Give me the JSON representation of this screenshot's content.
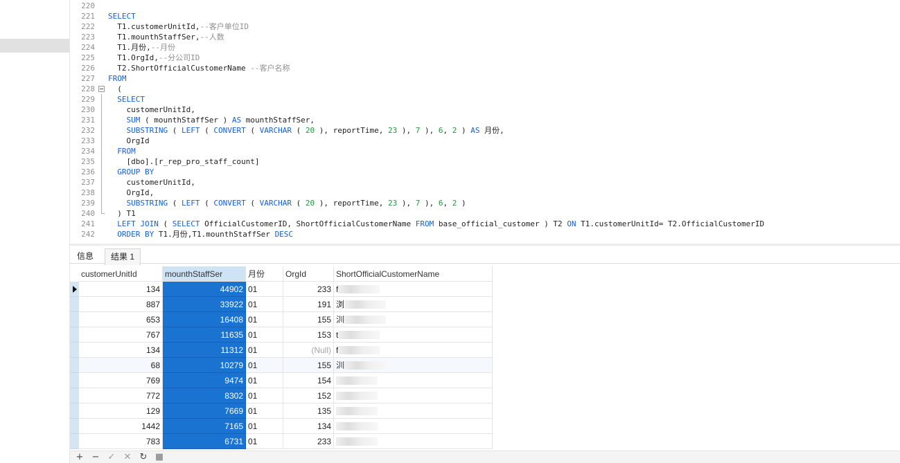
{
  "editor": {
    "lines": [
      {
        "n": "220",
        "segs": []
      },
      {
        "n": "221",
        "segs": [
          {
            "t": "SELECT",
            "c": "kw"
          }
        ]
      },
      {
        "n": "222",
        "segs": [
          {
            "t": "  T1.customerUnitId,",
            "c": ""
          },
          {
            "t": "--客户单位ID",
            "c": "cmt"
          }
        ]
      },
      {
        "n": "223",
        "segs": [
          {
            "t": "  T1.mounthStaffSer,",
            "c": ""
          },
          {
            "t": "--人数",
            "c": "cmt"
          }
        ]
      },
      {
        "n": "224",
        "segs": [
          {
            "t": "  T1.月份,",
            "c": ""
          },
          {
            "t": "--月份",
            "c": "cmt"
          }
        ]
      },
      {
        "n": "225",
        "segs": [
          {
            "t": "  T1.OrgId,",
            "c": ""
          },
          {
            "t": "--分公司ID",
            "c": "cmt"
          }
        ]
      },
      {
        "n": "226",
        "segs": [
          {
            "t": "  T2.ShortOfficialCustomerName ",
            "c": ""
          },
          {
            "t": "--客户名称",
            "c": "cmt"
          }
        ]
      },
      {
        "n": "227",
        "segs": [
          {
            "t": "FROM",
            "c": "kw"
          }
        ]
      },
      {
        "n": "228",
        "fold": "box",
        "segs": [
          {
            "t": "  (",
            "c": ""
          }
        ]
      },
      {
        "n": "229",
        "fold": "line",
        "segs": [
          {
            "t": "  SELECT",
            "c": "kw"
          }
        ]
      },
      {
        "n": "230",
        "fold": "line",
        "segs": [
          {
            "t": "    customerUnitId,",
            "c": ""
          }
        ]
      },
      {
        "n": "231",
        "fold": "line",
        "segs": [
          {
            "t": "    ",
            "c": ""
          },
          {
            "t": "SUM",
            "c": "kw"
          },
          {
            "t": " ( mounthStaffSer ) ",
            "c": ""
          },
          {
            "t": "AS",
            "c": "kw"
          },
          {
            "t": " mounthStaffSer,",
            "c": ""
          }
        ]
      },
      {
        "n": "232",
        "fold": "line",
        "segs": [
          {
            "t": "    ",
            "c": ""
          },
          {
            "t": "SUBSTRING",
            "c": "kw"
          },
          {
            "t": " ( ",
            "c": ""
          },
          {
            "t": "LEFT",
            "c": "kw"
          },
          {
            "t": " ( ",
            "c": ""
          },
          {
            "t": "CONVERT",
            "c": "kw"
          },
          {
            "t": " ( ",
            "c": ""
          },
          {
            "t": "VARCHAR",
            "c": "kw"
          },
          {
            "t": " ( ",
            "c": ""
          },
          {
            "t": "20",
            "c": "num"
          },
          {
            "t": " ), reportTime, ",
            "c": ""
          },
          {
            "t": "23",
            "c": "num"
          },
          {
            "t": " ), ",
            "c": ""
          },
          {
            "t": "7",
            "c": "num"
          },
          {
            "t": " ), ",
            "c": ""
          },
          {
            "t": "6",
            "c": "num"
          },
          {
            "t": ", ",
            "c": ""
          },
          {
            "t": "2",
            "c": "num"
          },
          {
            "t": " ) ",
            "c": ""
          },
          {
            "t": "AS",
            "c": "kw"
          },
          {
            "t": " 月份,",
            "c": ""
          }
        ]
      },
      {
        "n": "233",
        "fold": "line",
        "segs": [
          {
            "t": "    OrgId",
            "c": ""
          }
        ]
      },
      {
        "n": "234",
        "fold": "line",
        "segs": [
          {
            "t": "  FROM",
            "c": "kw"
          }
        ]
      },
      {
        "n": "235",
        "fold": "line",
        "segs": [
          {
            "t": "    [dbo].[r_rep_pro_staff_count]",
            "c": ""
          }
        ]
      },
      {
        "n": "236",
        "fold": "line",
        "segs": [
          {
            "t": "  GROUP BY",
            "c": "kw"
          }
        ]
      },
      {
        "n": "237",
        "fold": "line",
        "segs": [
          {
            "t": "    customerUnitId,",
            "c": ""
          }
        ]
      },
      {
        "n": "238",
        "fold": "line",
        "segs": [
          {
            "t": "    OrgId,",
            "c": ""
          }
        ]
      },
      {
        "n": "239",
        "fold": "line",
        "segs": [
          {
            "t": "    ",
            "c": ""
          },
          {
            "t": "SUBSTRING",
            "c": "kw"
          },
          {
            "t": " ( ",
            "c": ""
          },
          {
            "t": "LEFT",
            "c": "kw"
          },
          {
            "t": " ( ",
            "c": ""
          },
          {
            "t": "CONVERT",
            "c": "kw"
          },
          {
            "t": " ( ",
            "c": ""
          },
          {
            "t": "VARCHAR",
            "c": "kw"
          },
          {
            "t": " ( ",
            "c": ""
          },
          {
            "t": "20",
            "c": "num"
          },
          {
            "t": " ), reportTime, ",
            "c": ""
          },
          {
            "t": "23",
            "c": "num"
          },
          {
            "t": " ), ",
            "c": ""
          },
          {
            "t": "7",
            "c": "num"
          },
          {
            "t": " ), ",
            "c": ""
          },
          {
            "t": "6",
            "c": "num"
          },
          {
            "t": ", ",
            "c": ""
          },
          {
            "t": "2",
            "c": "num"
          },
          {
            "t": " )",
            "c": ""
          }
        ]
      },
      {
        "n": "240",
        "fold": "end",
        "segs": [
          {
            "t": "  ) T1",
            "c": ""
          }
        ]
      },
      {
        "n": "241",
        "segs": [
          {
            "t": "  ",
            "c": ""
          },
          {
            "t": "LEFT JOIN",
            "c": "kw"
          },
          {
            "t": " ( ",
            "c": ""
          },
          {
            "t": "SELECT",
            "c": "kw"
          },
          {
            "t": " OfficialCustomerID, ShortOfficialCustomerName ",
            "c": ""
          },
          {
            "t": "FROM",
            "c": "kw"
          },
          {
            "t": " base_official_customer ) T2 ",
            "c": ""
          },
          {
            "t": "ON",
            "c": "kw"
          },
          {
            "t": " T1.customerUnitId= T2.OfficialCustomerID",
            "c": ""
          }
        ]
      },
      {
        "n": "242",
        "segs": [
          {
            "t": "  ",
            "c": ""
          },
          {
            "t": "ORDER BY",
            "c": "kw"
          },
          {
            "t": " T1.月份,T1.mounthStaffSer ",
            "c": ""
          },
          {
            "t": "DESC",
            "c": "kw"
          }
        ]
      }
    ]
  },
  "tabs": {
    "info": "信息",
    "result": "结果 1"
  },
  "grid": {
    "columns": [
      "customerUnitId",
      "mounthStaffSer",
      "月份",
      "OrgId",
      "ShortOfficialCustomerName"
    ],
    "rows": [
      [
        "134",
        "44902",
        "01",
        "233",
        "f"
      ],
      [
        "887",
        "33922",
        "01",
        "191",
        "浏"
      ],
      [
        "653",
        "16408",
        "01",
        "155",
        "汌"
      ],
      [
        "767",
        "11635",
        "01",
        "153",
        "t"
      ],
      [
        "134",
        "11312",
        "01",
        "(Null)",
        "f"
      ],
      [
        "68",
        "10279",
        "01",
        "155",
        "汌"
      ],
      [
        "769",
        "9474",
        "01",
        "154",
        ""
      ],
      [
        "772",
        "8302",
        "01",
        "152",
        ""
      ],
      [
        "129",
        "7669",
        "01",
        "135",
        ""
      ],
      [
        "1442",
        "7165",
        "01",
        "134",
        ""
      ],
      [
        "783",
        "6731",
        "01",
        "233",
        ""
      ]
    ]
  },
  "toolbar": {
    "add_icon": "+",
    "remove_icon": "−",
    "apply_icon": "✓",
    "discard_icon": "✕",
    "refresh_icon": "↻",
    "stop_icon": "■"
  },
  "colors": {
    "keyword": "#1560d8",
    "number": "#1c9a3a",
    "comment": "#8f8f8f",
    "selection": "#1a73d0"
  }
}
